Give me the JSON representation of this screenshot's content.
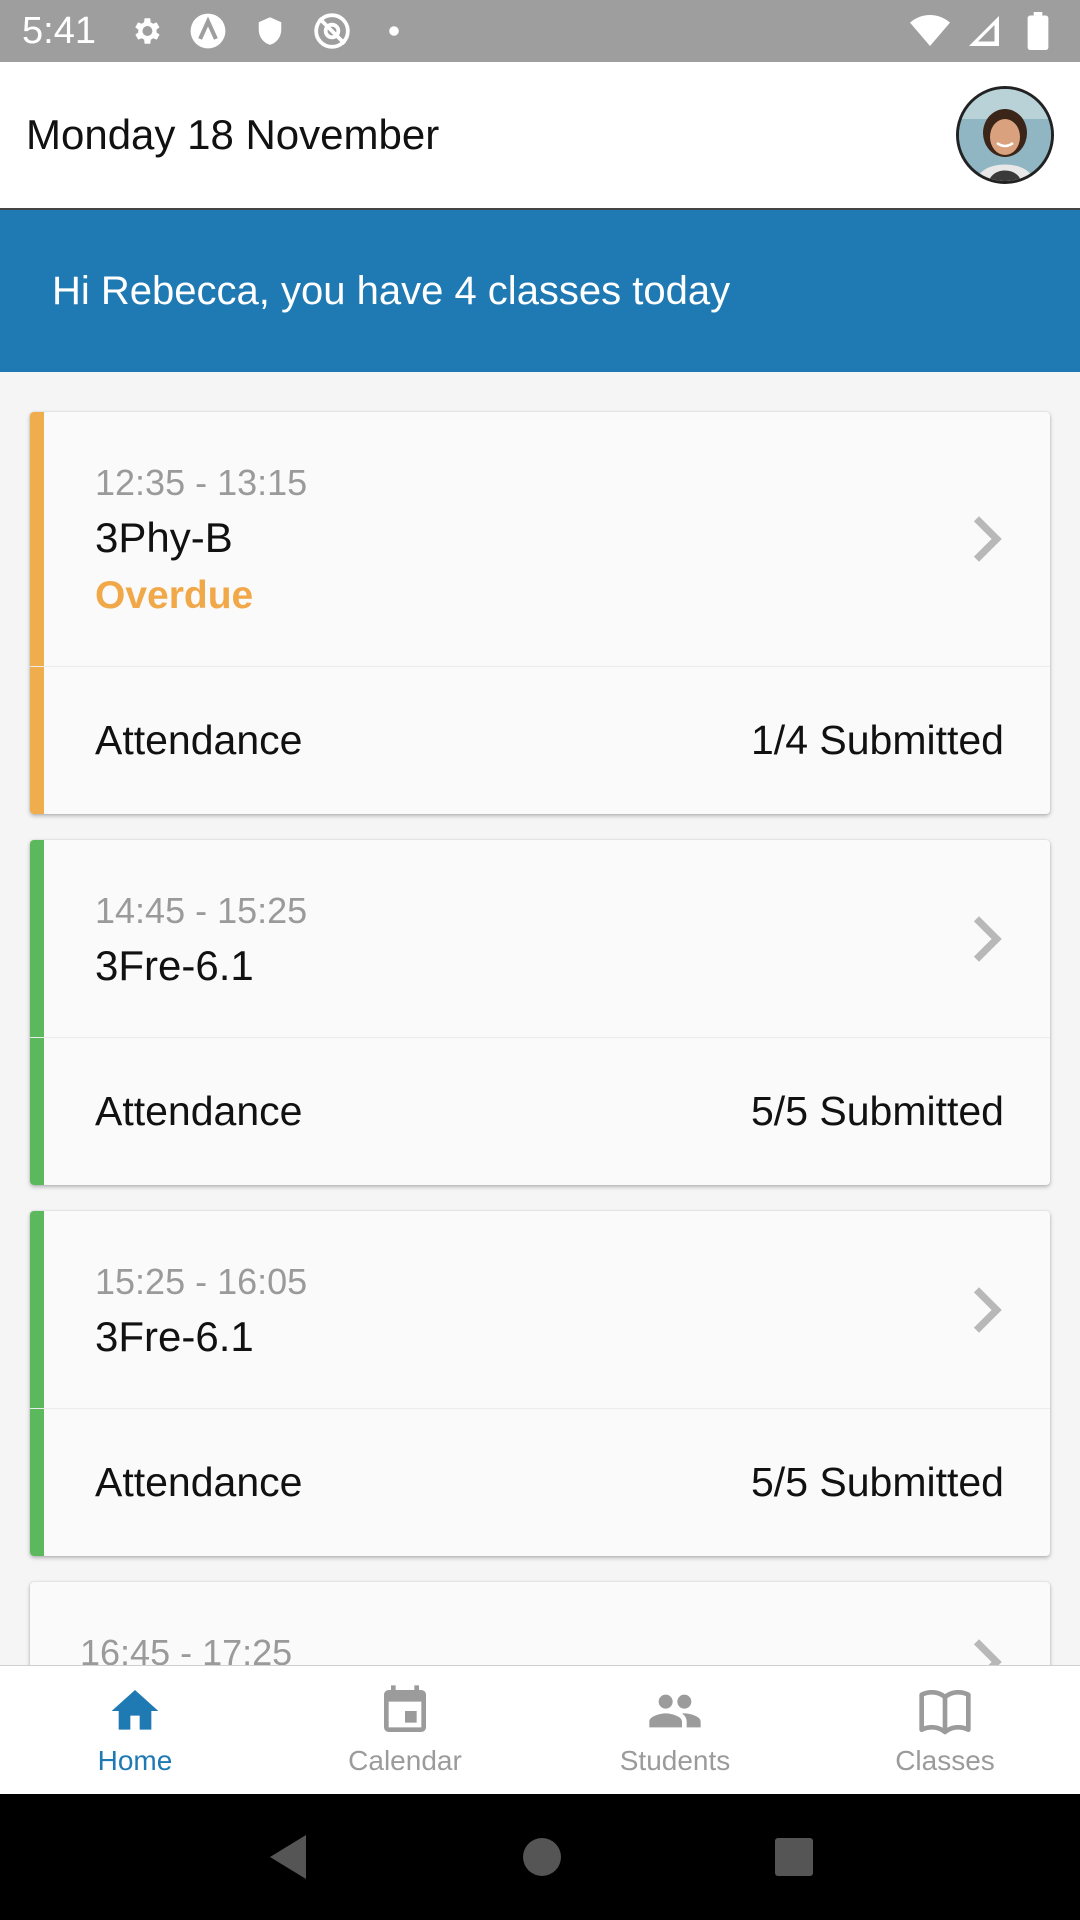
{
  "status_bar": {
    "time": "5:41",
    "left_icons": [
      "gear-icon",
      "vpn-app-icon",
      "shield-icon",
      "at-icon",
      "dot-icon"
    ],
    "right_icons": [
      "wifi-icon",
      "signal-icon",
      "battery-icon"
    ]
  },
  "header": {
    "date": "Monday 18 November",
    "avatar": "user-avatar"
  },
  "greeting": "Hi Rebecca, you have 4 classes today",
  "classes": [
    {
      "time": "12:35 - 13:15",
      "name": "3Phy-B",
      "status": "Overdue",
      "attendance_label": "Attendance",
      "attendance_value": "1/4 Submitted",
      "accent": "#f0ad4e"
    },
    {
      "time": "14:45 - 15:25",
      "name": "3Fre-6.1",
      "attendance_label": "Attendance",
      "attendance_value": "5/5 Submitted",
      "accent": "#5cb85c"
    },
    {
      "time": "15:25 - 16:05",
      "name": "3Fre-6.1",
      "attendance_label": "Attendance",
      "attendance_value": "5/5 Submitted",
      "accent": "#5cb85c"
    },
    {
      "time": "16:45 - 17:25"
    }
  ],
  "bottom_nav": [
    {
      "label": "Home",
      "icon": "home-icon",
      "active": true
    },
    {
      "label": "Calendar",
      "icon": "calendar-icon",
      "active": false
    },
    {
      "label": "Students",
      "icon": "students-icon",
      "active": false
    },
    {
      "label": "Classes",
      "icon": "book-icon",
      "active": false
    }
  ],
  "colors": {
    "primary": "#1f7ab3",
    "overdue": "#f0ad4e",
    "complete": "#5cb85c"
  }
}
